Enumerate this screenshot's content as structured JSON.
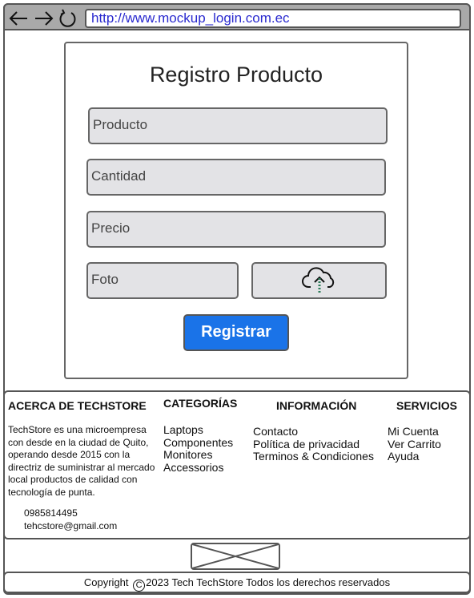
{
  "browser": {
    "url": "http://www.mockup_login.com.ec"
  },
  "form": {
    "title": "Registro Producto",
    "fields": {
      "producto": "Producto",
      "cantidad": "Cantidad",
      "precio": "Precio",
      "foto": "Foto"
    },
    "upload_icon": "cloud-upload-icon",
    "submit_label": "Registrar",
    "submit_color": "#1a73e8"
  },
  "footer": {
    "about": {
      "title": "ACERCA DE TECHSTORE",
      "text": "TechStore es una microempresa con desde en la ciudad de Quito, operando desde 2015 con la directriz de suministrar al mercado local productos de calidad con tecnología de punta.",
      "phone": "0985814495",
      "email": "tehcstore@gmail.com"
    },
    "categories": {
      "title": "CATEGORÍAS",
      "items": [
        "Laptops",
        "Componentes",
        "Monitores",
        "Accessorios"
      ]
    },
    "info": {
      "title": "INFORMACIÓN",
      "items": [
        "Contacto",
        "Política de privacidad",
        "Terminos & Condiciones"
      ]
    },
    "services": {
      "title": "SERVICIOS",
      "items": [
        "Mi Cuenta",
        "Ver Carrito",
        "Ayuda"
      ]
    }
  },
  "copyright": {
    "symbol": "C",
    "text": "2023 Tech TechStore Todos los derechos reservados",
    "prefix": "Copyright"
  }
}
